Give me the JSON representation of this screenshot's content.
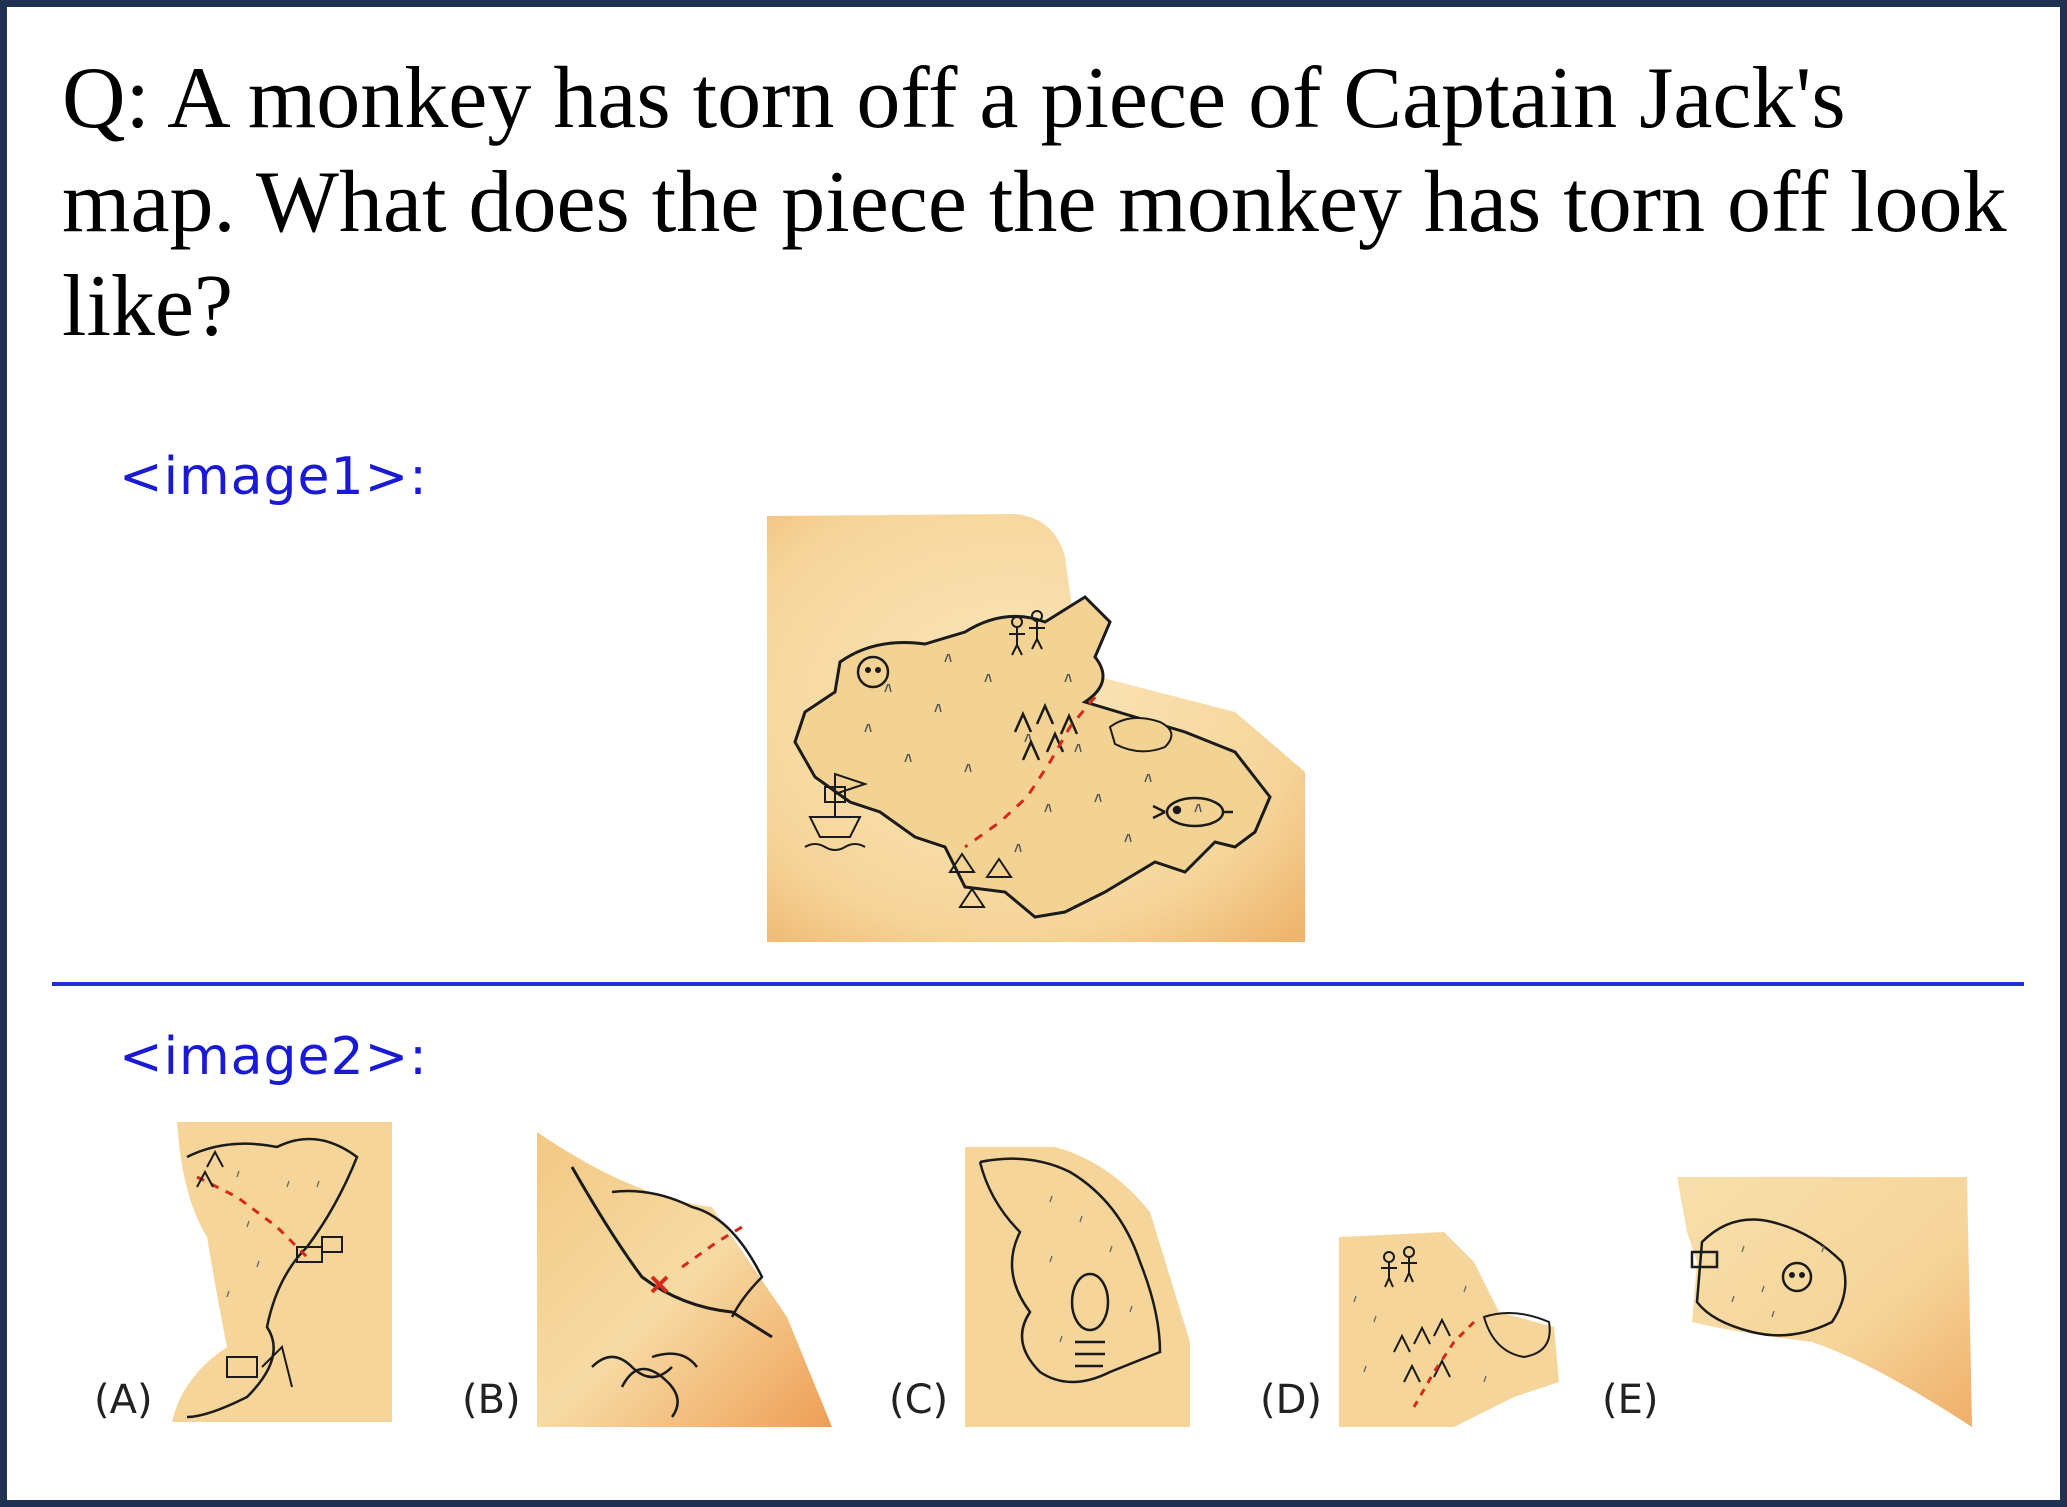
{
  "question": "Q: A monkey has torn off a piece of Captain Jack's map. What does the piece the monkey has torn off look like?",
  "image1_label": "<image1>:",
  "image2_label": "<image2>:",
  "options": [
    "(A)",
    "(B)",
    "(C)",
    "(D)",
    "(E)"
  ],
  "colors": {
    "border": "#1f3150",
    "label_blue": "#1a1ad6",
    "divider": "#1f2fd0",
    "parchment": "#f6d9a0",
    "parchment_edge": "#efb874",
    "ink": "#1b1b1b",
    "trail_red": "#d42a1c"
  }
}
